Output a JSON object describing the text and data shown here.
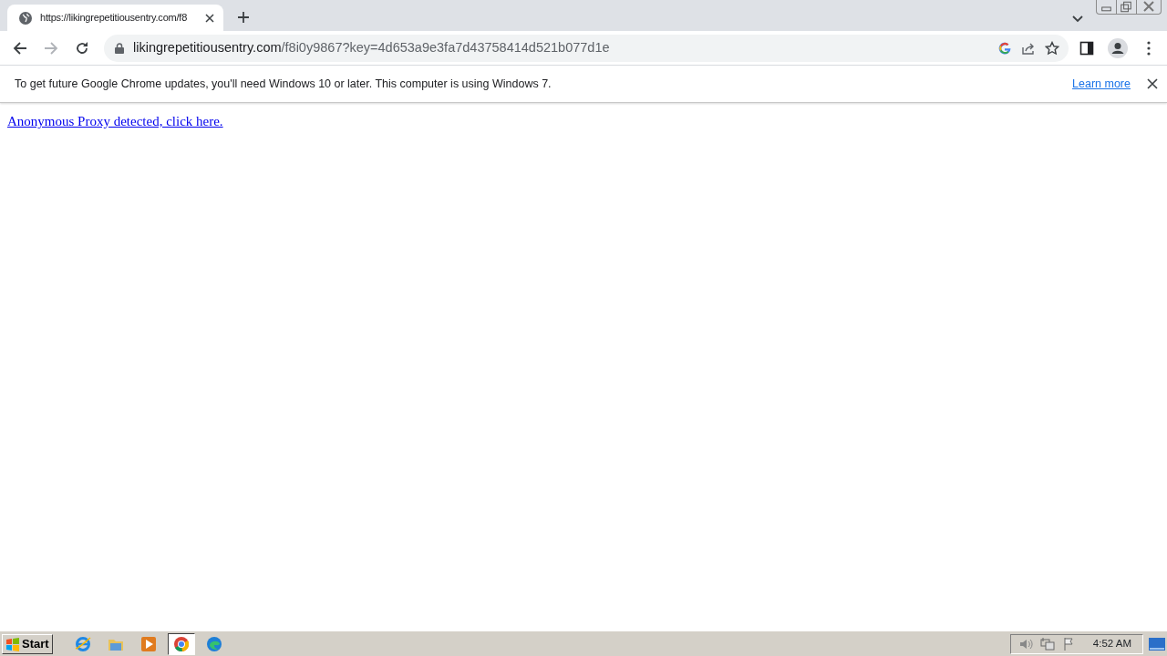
{
  "tab": {
    "title": "https://likingrepetitiousentry.com/f8",
    "selected": true
  },
  "address_bar": {
    "domain": "likingrepetitiousentry.com",
    "path": "/f8i0y9867?key=4d653a9e3fa7d43758414d521b077d1e"
  },
  "infobar": {
    "message": "To get future Google Chrome updates, you'll need Windows 10 or later. This computer is using Windows 7.",
    "link": "Learn more"
  },
  "page": {
    "link": "Anonymous Proxy detected, click here."
  },
  "taskbar": {
    "start": "Start",
    "apps": [
      {
        "kind": "ie",
        "selected": false
      },
      {
        "kind": "folder",
        "selected": false
      },
      {
        "kind": "media",
        "selected": false
      },
      {
        "kind": "chrome",
        "selected": true
      },
      {
        "kind": "edge",
        "selected": false
      }
    ],
    "clock": "4:52 AM"
  }
}
